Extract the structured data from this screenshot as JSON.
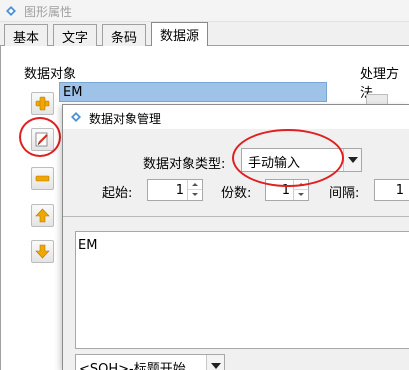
{
  "window": {
    "title": "图形属性"
  },
  "tabs": [
    {
      "label": "基本"
    },
    {
      "label": "文字"
    },
    {
      "label": "条码"
    },
    {
      "label": "数据源"
    }
  ],
  "data_objects": {
    "group_label": "数据对象",
    "items": [
      "EM"
    ]
  },
  "processing": {
    "group_label": "处理方法"
  },
  "dialog": {
    "title": "数据对象管理",
    "type_label": "数据对象类型:",
    "type_value": "手动输入",
    "start_label": "起始:",
    "start_value": "1",
    "copies_label": "份数:",
    "copies_value": "1",
    "interval_label": "间隔:",
    "interval_value": "1",
    "content": "EM",
    "control_char": "<SOH>-标题开始"
  },
  "colors": {
    "accent_selection": "#9fc3e8",
    "annotation_red": "#e02020"
  }
}
